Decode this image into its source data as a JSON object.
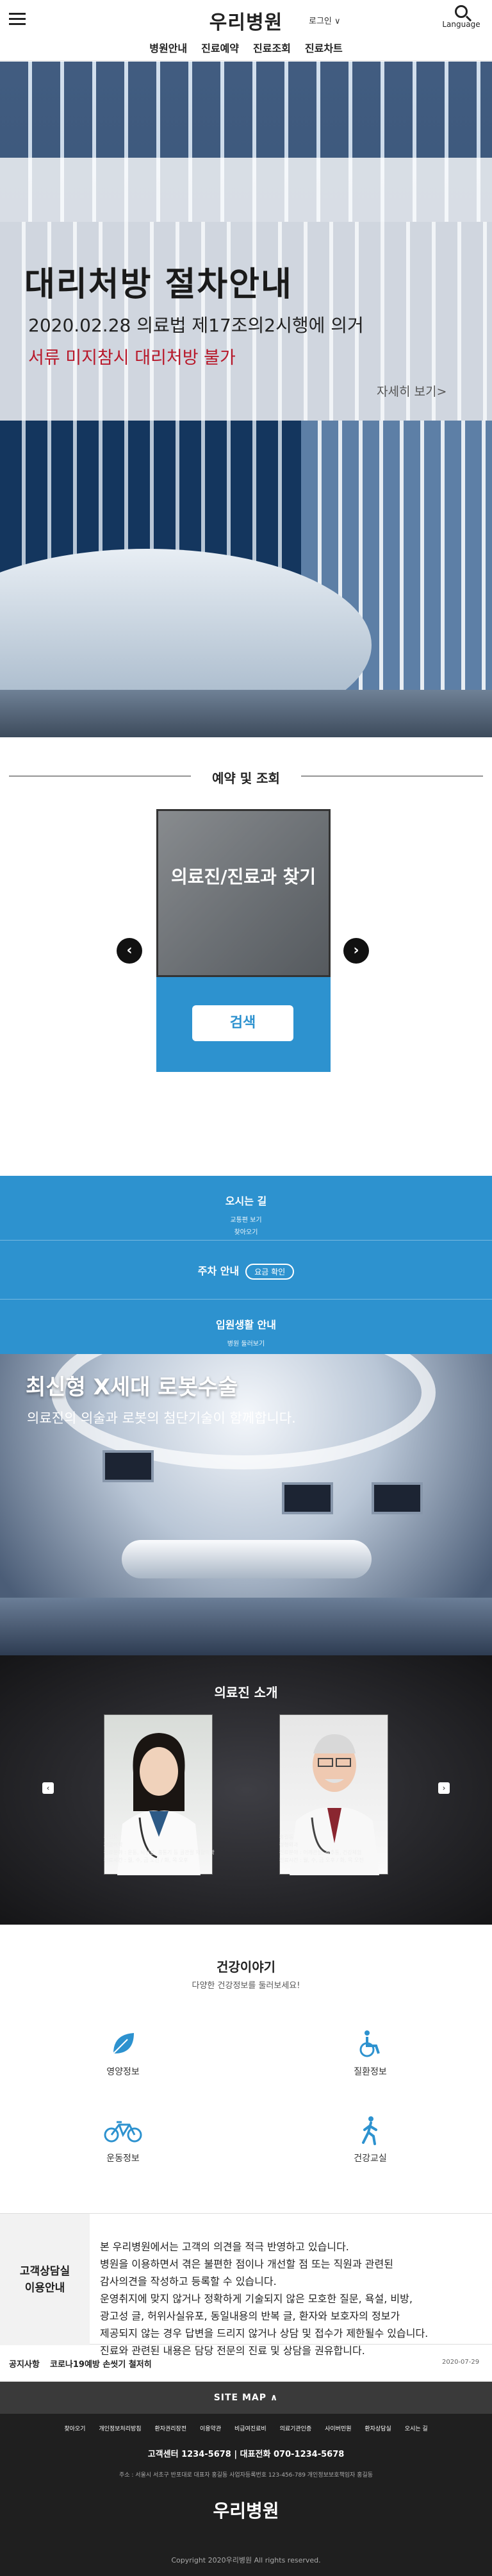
{
  "header": {
    "logo": "우리병원",
    "login": "로그인 ∨",
    "language": "Language",
    "nav": [
      "병원안내",
      "진료예약",
      "진료조회",
      "진료차트"
    ]
  },
  "hero": {
    "title": "대리처방 절차안내",
    "sub1": "2020.02.28 의료법 제17조의2시행에 의거",
    "sub2": "서류 미지참시 대리처방 불가",
    "more": "자세히 보기>"
  },
  "reservation": {
    "title": "예약 및 조회",
    "card_label": "의료진/진료과 찾기",
    "search_button": "검색",
    "prev": "‹",
    "next": "›"
  },
  "info_bars": [
    {
      "title": "오시는 길",
      "sub": "교통편 보기",
      "sub2": "찾아오기"
    },
    {
      "title": "주차 안내",
      "badge": "요금 확인"
    },
    {
      "title": "입원생활 안내",
      "sub": "병원 둘러보기"
    }
  ],
  "robot": {
    "title": "최신형 X세대 로봇수술",
    "sub": "의료진의 의술과 로봇의 첨단기술이 함께합니다."
  },
  "doctors": {
    "title": "의료진 소개",
    "prev": "‹",
    "next": "›",
    "items": [
      {
        "name": "홍길동",
        "dept": "재활의학",
        "lines": [
          "진료분야 : 운동, 뇌신경, 흉통기 등 골관절 재활의학",
          "진료시간 : 월, 수, 금 오전 / 화, 목 오후"
        ]
      },
      {
        "name": "홍길동",
        "dept": "정형외과",
        "lines": [
          "진료분야 : 어깨관절, 척추통, 건강체험",
          "진료시간 : 월, 수, 금 오후 / 화, 목 오전"
        ]
      }
    ]
  },
  "health": {
    "title": "건강이야기",
    "sub": "다양한 건강정보를 둘러보세요!",
    "items": [
      {
        "label": "영양정보",
        "icon": "leaf-icon"
      },
      {
        "label": "질환정보",
        "icon": "wheelchair-icon"
      },
      {
        "label": "운동정보",
        "icon": "bicycle-icon"
      },
      {
        "label": "건강교실",
        "icon": "walking-icon"
      }
    ]
  },
  "counsel": {
    "label1": "고객상담실",
    "label2": "이용안내",
    "lines": [
      "본 우리병원에서는 고객의 의견을 적극 반영하고 있습니다.",
      "병원을 이용하면서 겪은 불편한 점이나 개선할 점 또는 직원과 관련된",
      "감사의견을 작성하고 등록할 수 있습니다.",
      "운영취지에 맞지 않거나 정확하게 기술되지 않은 모호한 질문, 욕설, 비방,",
      "광고성 글, 허위사실유포, 동일내용의 반복 글, 환자와 보호자의 정보가",
      "제공되지 않는 경우 답변을 드리지 않거나 상담 및 접수가 제한될수 있습니다.",
      "진료와 관련된 내용은 담당 전문의 진료 및 상담을 권유합니다."
    ]
  },
  "notice": {
    "label": "공지사항",
    "text": "코로나19예방 손씻기 철저히",
    "date": "2020-07-29"
  },
  "footer": {
    "sitemap": "SITE MAP ∧",
    "links": [
      "찾아오기",
      "개인정보처리방침",
      "환자권리장전",
      "이용약관",
      "비급여진료비",
      "의료기관인증",
      "사이버민원",
      "환자상담실",
      "오시는 길"
    ],
    "tel": "고객센터 1234-5678  |  대표전화 070-1234-5678",
    "address": "주소 : 서울시 서초구 반포대로  대표자 홍길동  사업자등록번호 123-456-789  개인정보보호책임자 홍길동",
    "logo": "우리병원",
    "copyright": "Copyright 2020우리병원 All rights reserved."
  },
  "colors": {
    "accent": "#2d92cf",
    "alert": "#b8182a",
    "footer": "#1f1f1f"
  }
}
